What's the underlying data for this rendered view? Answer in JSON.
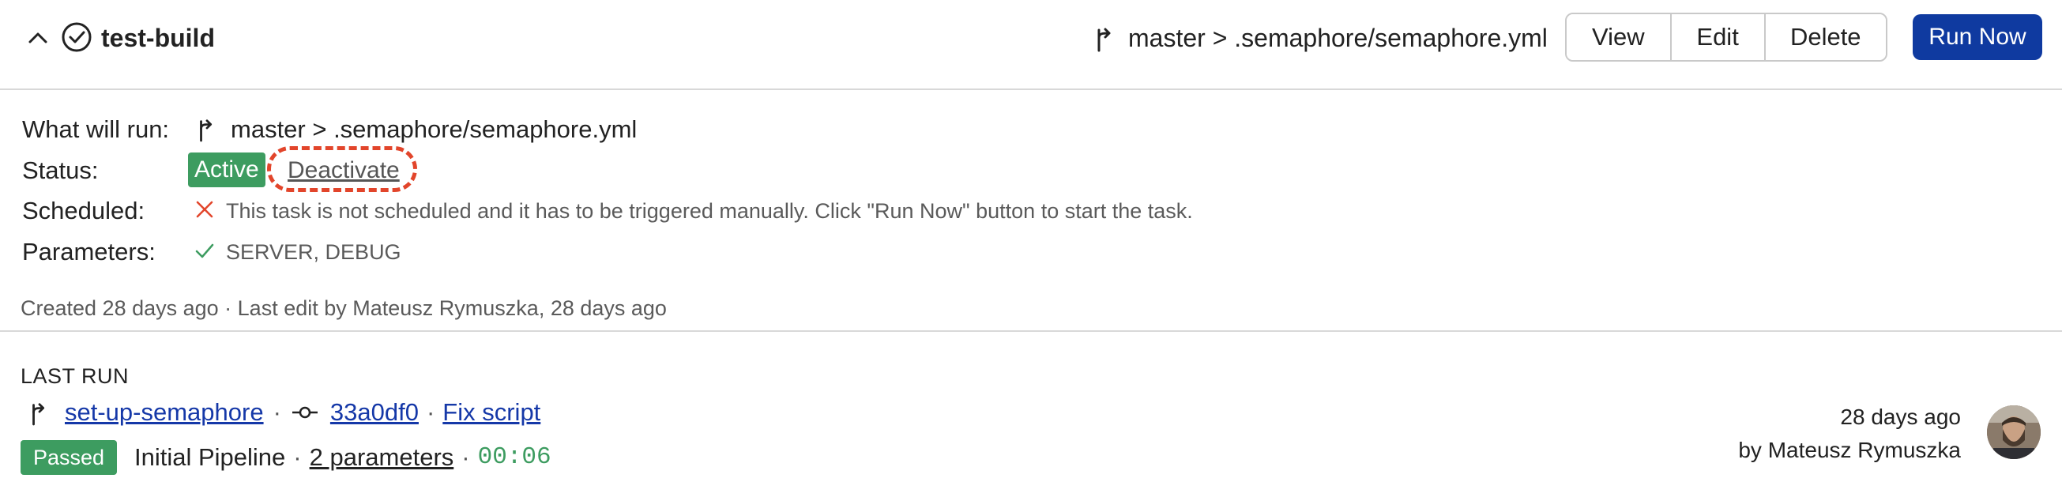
{
  "header": {
    "task_name": "test-build",
    "branch_path": "master > .semaphore/semaphore.yml",
    "buttons": {
      "view": "View",
      "edit": "Edit",
      "delete": "Delete"
    },
    "run_now": "Run Now",
    "colors": {
      "primary": "#0f3aa0",
      "border": "#c9c9c9"
    }
  },
  "details": {
    "what_will_run_label": "What will run:",
    "what_will_run_value": "master > .semaphore/semaphore.yml",
    "status_label": "Status:",
    "status_value": "Active",
    "status_action": "Deactivate",
    "scheduled_label": "Scheduled:",
    "scheduled_value": "This task is not scheduled and it has to be triggered manually. Click \"Run Now\" button to start the task.",
    "parameters_label": "Parameters:",
    "parameters_value": "SERVER, DEBUG",
    "meta": "Created 28 days ago · Last edit by Mateusz Rymuszka, 28 days ago",
    "colors": {
      "active": "#3d9c60",
      "error": "#e2452b",
      "success": "#3d9c60"
    }
  },
  "last_run": {
    "heading": "LAST RUN",
    "branch": "set-up-semaphore",
    "sep": "·",
    "commit": "33a0df0",
    "commit_message": "Fix script",
    "result": "Passed",
    "pipeline": "Initial Pipeline",
    "parameters_link": "2 parameters",
    "duration": "00:06",
    "time_ago": "28 days ago",
    "by": "by Mateusz Rymuszka"
  },
  "icons": [
    "chevron-up-icon",
    "check-circle-icon",
    "branch-icon",
    "x-icon",
    "check-icon",
    "commit-icon",
    "avatar"
  ]
}
